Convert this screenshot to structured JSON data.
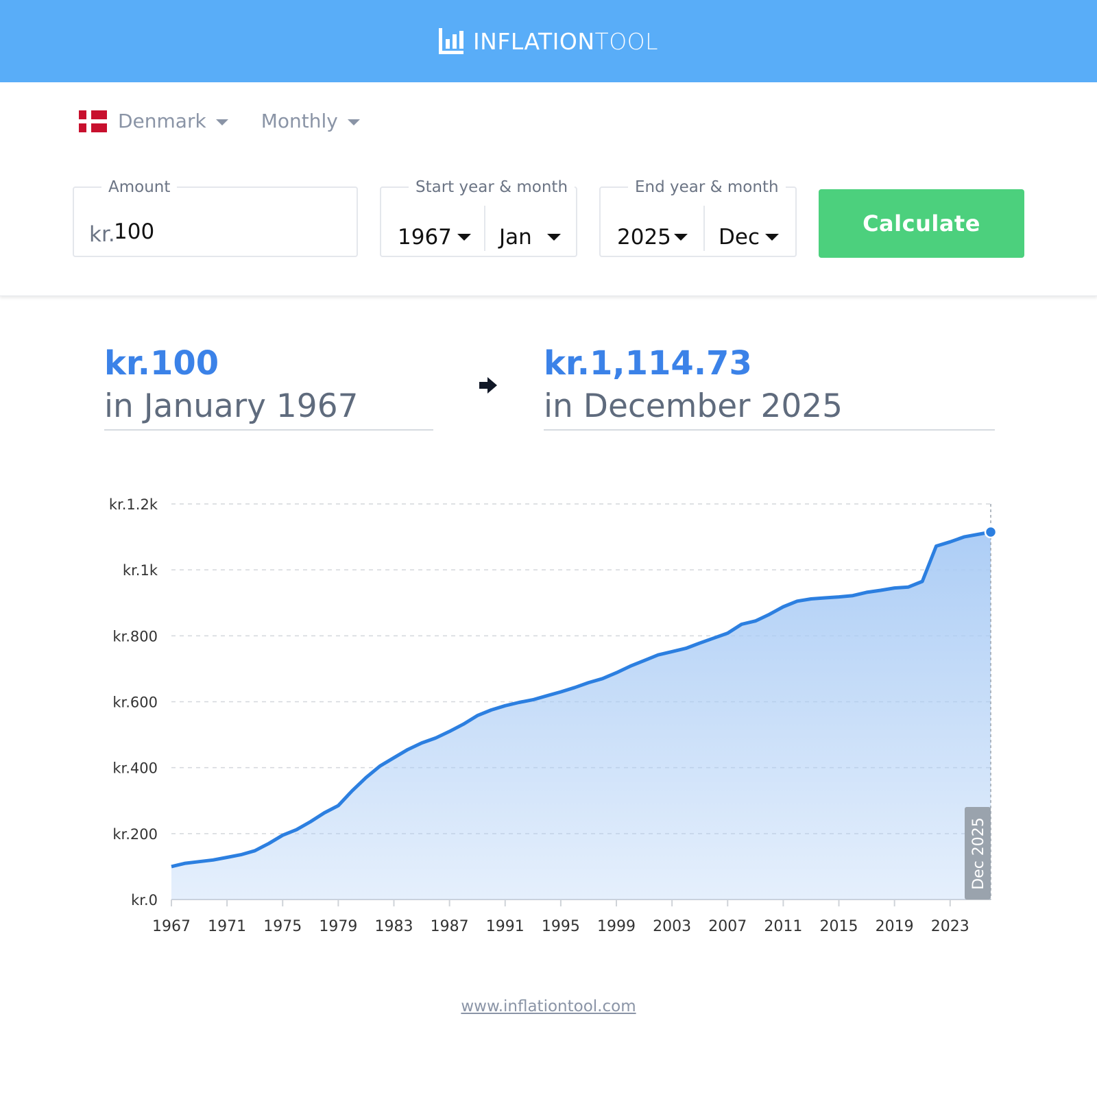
{
  "header": {
    "logo_bold": "INFLATION",
    "logo_light": "TOOL"
  },
  "selectors": {
    "country": "Denmark",
    "frequency": "Monthly"
  },
  "form": {
    "amount_label": "Amount",
    "amount_prefix": "kr.",
    "amount_value": "100",
    "start_label": "Start year & month",
    "start_year": "1967",
    "start_month": "Jan",
    "end_label": "End year & month",
    "end_year": "2025",
    "end_month": "Dec",
    "calculate_label": "Calculate"
  },
  "result": {
    "from_amount": "kr.100",
    "from_when": "in January 1967",
    "to_amount": "kr.1,114.73",
    "to_when": "in December 2025"
  },
  "chart_data": {
    "type": "area",
    "x": [
      1967,
      1968,
      1969,
      1970,
      1971,
      1972,
      1973,
      1974,
      1975,
      1976,
      1977,
      1978,
      1979,
      1980,
      1981,
      1982,
      1983,
      1984,
      1985,
      1986,
      1987,
      1988,
      1989,
      1990,
      1991,
      1992,
      1993,
      1994,
      1995,
      1996,
      1997,
      1998,
      1999,
      2000,
      2001,
      2002,
      2003,
      2004,
      2005,
      2006,
      2007,
      2008,
      2009,
      2010,
      2011,
      2012,
      2013,
      2014,
      2015,
      2016,
      2017,
      2018,
      2019,
      2020,
      2021,
      2022,
      2023,
      2024,
      2025.92
    ],
    "y": [
      100,
      110,
      115,
      120,
      128,
      136,
      148,
      170,
      195,
      212,
      236,
      263,
      285,
      330,
      370,
      405,
      430,
      455,
      475,
      490,
      510,
      532,
      558,
      575,
      588,
      598,
      606,
      618,
      630,
      643,
      658,
      670,
      688,
      708,
      725,
      742,
      752,
      762,
      778,
      793,
      808,
      835,
      845,
      865,
      888,
      905,
      912,
      915,
      918,
      922,
      932,
      938,
      945,
      948,
      965,
      1072,
      1085,
      1100,
      1114.73
    ],
    "ylim": [
      0,
      1200
    ],
    "y_ticks": [
      {
        "value": 0,
        "label": "kr.0"
      },
      {
        "value": 200,
        "label": "kr.200"
      },
      {
        "value": 400,
        "label": "kr.400"
      },
      {
        "value": 600,
        "label": "kr.600"
      },
      {
        "value": 800,
        "label": "kr.800"
      },
      {
        "value": 1000,
        "label": "kr.1k"
      },
      {
        "value": 1200,
        "label": "kr.1.2k"
      }
    ],
    "x_ticks": [
      1967,
      1971,
      1975,
      1979,
      1983,
      1987,
      1991,
      1995,
      1999,
      2003,
      2007,
      2011,
      2015,
      2019,
      2023
    ],
    "xlim": [
      1967,
      2025.92
    ],
    "end_label": "Dec 2025",
    "grid": true,
    "line_color": "#2c7fe0",
    "fill_color": "#a9cbf5"
  },
  "footer": {
    "link": "www.inflationtool.com"
  }
}
